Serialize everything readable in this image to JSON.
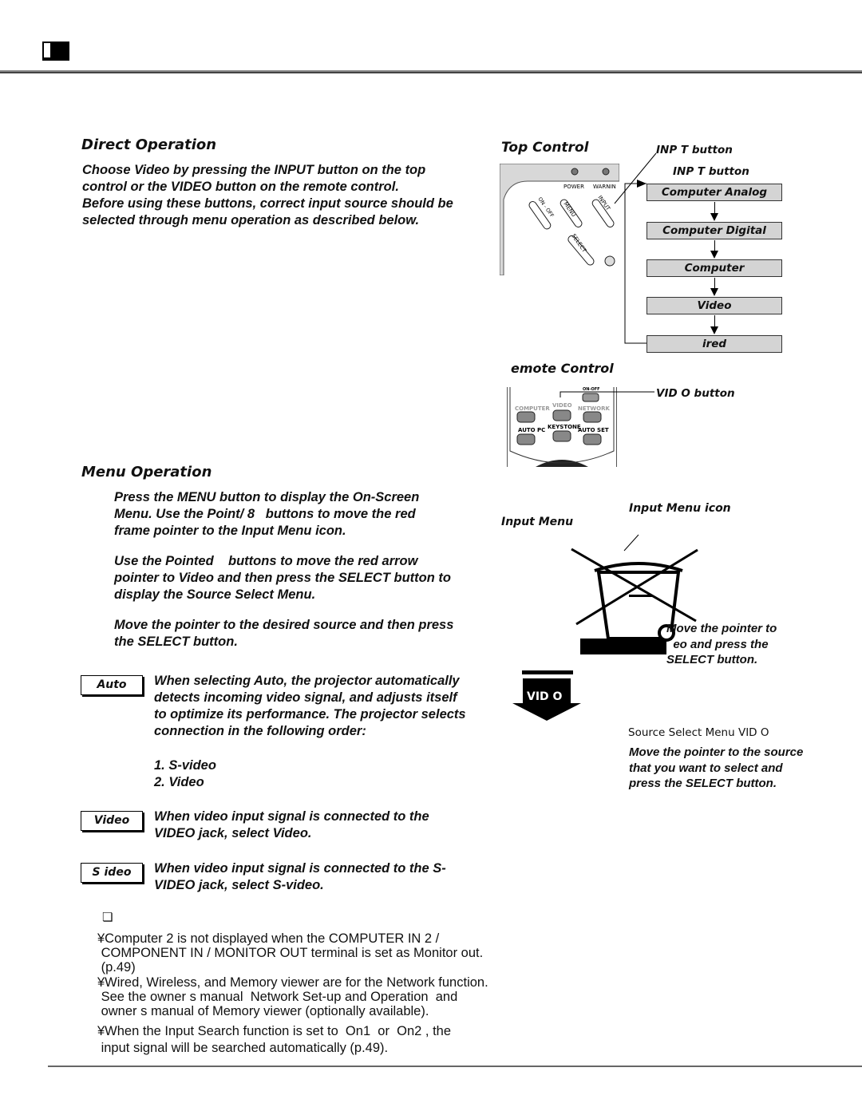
{
  "header": {
    "icon": "page-marker-icon"
  },
  "direct": {
    "title": "Direct Operation",
    "text": [
      "Choose Video by pressing the INPUT button on the top",
      "control or the VIDEO button on the remote control.",
      "Before using these buttons, correct input source should be",
      "selected through menu operation as described below."
    ]
  },
  "top_control": {
    "title": "Top Control",
    "callout": "INP   T button",
    "leds": [
      "POWER",
      "WARNIN"
    ],
    "buttons": [
      "ON - OFF",
      "MENU",
      "INPUT",
      "SELECT"
    ],
    "flow_title": "INP   T button",
    "flow": [
      "Computer      Analog",
      "Computer      Digital",
      "Computer",
      "Video",
      "ired"
    ]
  },
  "remote_control": {
    "title": "emote Control",
    "callout": "VID   O button",
    "buttons": [
      "COMPUTER",
      "VIDEO",
      "NETWORK",
      "AUTO PC",
      "KEYSTONE",
      "AUTO SET",
      "ON-OFF"
    ]
  },
  "menu": {
    "title": "Menu Operation",
    "steps": [
      [
        "Press the MENU button to display the On-Screen",
        "Menu. Use the Point/ 8   buttons to move the red",
        "frame pointer to the Input Menu icon."
      ],
      [
        "Use the Pointed    buttons to move the red arrow",
        "pointer to Video and then press the SELECT button to",
        "display the Source Select Menu."
      ],
      [
        "Move the pointer to the desired source and then press",
        "the SELECT button."
      ]
    ]
  },
  "input_menu": {
    "title": "Input Menu",
    "icon_label": "Input Menu icon",
    "caption": [
      "Move the pointer to",
      "  eo and press the",
      "SELECT button."
    ],
    "arrow_label": "VID  O",
    "source_title": "Source Select Menu   VID   O",
    "source_text": [
      "Move the pointer to the source",
      "that you want to select and",
      "press the SELECT button."
    ]
  },
  "options": [
    {
      "tag": "Auto",
      "text": [
        "When selecting Auto, the projector automatically",
        "detects incoming video signal, and adjusts itself",
        "to optimize its performance. The projector selects",
        "connection in the following order:"
      ],
      "order": [
        "1. S-video",
        "2. Video"
      ]
    },
    {
      "tag": "Video",
      "text": [
        "When video input signal is connected to the",
        "VIDEO jack, select Video."
      ]
    },
    {
      "tag": "S  ideo",
      "text": [
        "When video input signal is connected to the S-",
        "VIDEO jack, select S-video."
      ]
    }
  ],
  "notes": {
    "icon": "❏",
    "items": [
      [
        "¥Computer 2 is not displayed when the COMPUTER IN 2 /",
        " COMPONENT IN / MONITOR OUT terminal is set as Monitor out.",
        " (p.49)"
      ],
      [
        "¥Wired, Wireless, and Memory viewer are for the Network function.",
        " See the owner s manual  Network Set-up and Operation  and",
        " owner s manual of Memory viewer (optionally available)."
      ],
      [
        "¥When the Input Search function is set to  On1  or  On2 , the",
        " input signal will be searched automatically (p.49)."
      ]
    ]
  }
}
